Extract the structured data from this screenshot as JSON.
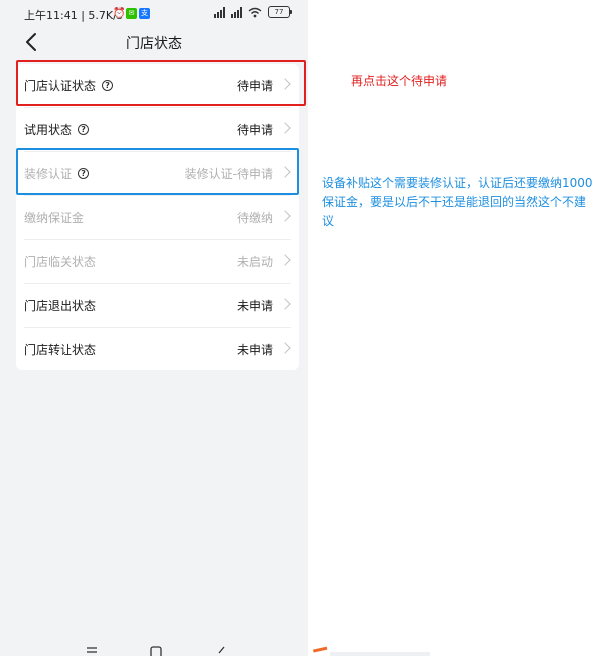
{
  "status_bar": {
    "time_speed": "上午11:41 | 5.7K/s",
    "battery": "77"
  },
  "header": {
    "title": "门店状态"
  },
  "rows": [
    {
      "label": "门店认证状态",
      "value": "待申请",
      "help": true
    },
    {
      "label": "试用状态",
      "value": "待申请",
      "help": true
    },
    {
      "label": "装修认证",
      "value": "装修认证-待申请",
      "help": true
    },
    {
      "label": "缴纳保证金",
      "value": "待缴纳",
      "help": false
    },
    {
      "label": "门店临关状态",
      "value": "未启动",
      "help": false
    },
    {
      "label": "门店退出状态",
      "value": "未申请",
      "help": false
    },
    {
      "label": "门店转让状态",
      "value": "未申请",
      "help": false
    }
  ],
  "annotations": {
    "red": "再点击这个待申请",
    "blue": "设备补贴这个需要装修认证，认证后还要缴纳1000保证金，要是以后不干还是能退回的当然这个不建议"
  },
  "colors": {
    "highlight_red": "#e32020",
    "highlight_blue": "#1e8fe0",
    "background": "#f2f3f5"
  }
}
